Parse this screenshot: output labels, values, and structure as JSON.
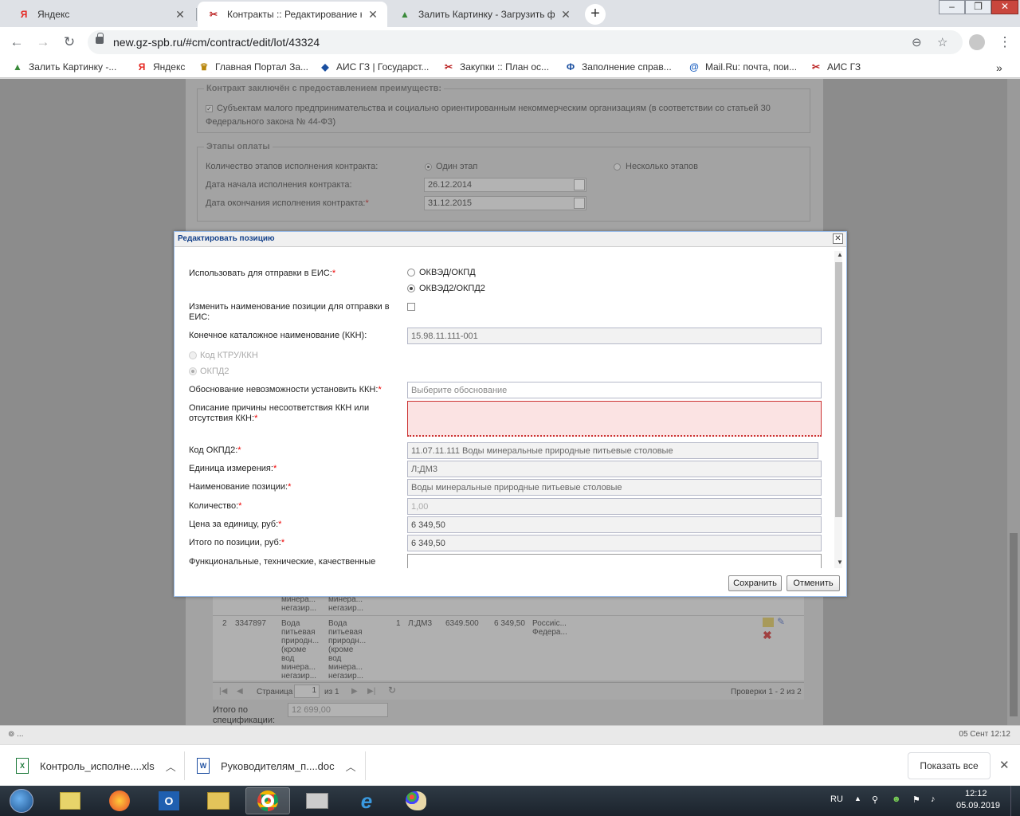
{
  "browser": {
    "tabs": [
      {
        "title": "Яндекс",
        "favicon": "Я"
      },
      {
        "title": "Контракты :: Редактирование ко",
        "favicon": "✂"
      },
      {
        "title": "Залить Картинку - Загрузить фо",
        "favicon": "▲"
      }
    ],
    "new_tab": "+",
    "url": "new.gz-spb.ru/#cm/contract/edit/lot/43324",
    "window_controls": {
      "minimize": "–",
      "restore": "❐",
      "close": "✕"
    },
    "bookmarks": [
      {
        "label": "Залить Картинку -...",
        "icon": "▲"
      },
      {
        "label": "Яндекс",
        "icon": "Я"
      },
      {
        "label": "Главная Портал За...",
        "icon": "♛"
      },
      {
        "label": "АИС ГЗ | Государст...",
        "icon": "◆"
      },
      {
        "label": "Закупки :: План ос...",
        "icon": "✂"
      },
      {
        "label": "Заполнение справ...",
        "icon": "Ф"
      },
      {
        "label": "Mail.Ru: почта, пои...",
        "icon": "@"
      },
      {
        "label": "АИС ГЗ",
        "icon": "✂"
      }
    ],
    "bookmarks_more": "»"
  },
  "background_form": {
    "preferences": {
      "legend": "Контракт заключён с предоставлением преимуществ:",
      "checkbox_text": "Субъектам малого предпринимательства и социально ориентированным некоммерческим организациям (в соответствии со статьей 30",
      "checkbox_text_2": "Федерального закона № 44-ФЗ)"
    },
    "payment": {
      "legend": "Этапы оплаты",
      "stages_label": "Количество этапов исполнения контракта:",
      "option_one": "Один этап",
      "option_many": "Несколько этапов",
      "start_label": "Дата начала исполнения контракта:",
      "start_value": "26.12.2014",
      "end_label": "Дата окончания исполнения контракта:",
      "end_value": "31.12.2015"
    },
    "grid": {
      "row1_frag": {
        "col3": "минера...\nнегазир...",
        "col4": "минера...\nнегазир..."
      },
      "row2": {
        "num": "2",
        "code": "3347897",
        "name": "Вода\nпитьевая\nприродн...\n(кроме\nвод\nминера...\nнегазир...",
        "name2": "Вода\nпитьевая\nприродн...\n(кроме\nвод\nминера...\nнегазир...",
        "qty": "1",
        "unit": "Л;ДМ3",
        "price": "6349.500",
        "total": "6 349,50",
        "country": "Россиiс...\nФедера..."
      },
      "pager": {
        "page_label": "Страница",
        "page_value": "1",
        "of_label": "из 1",
        "summary": "Проверки 1 - 2 из 2"
      }
    },
    "total_label": "Итого по\nспецификации:",
    "total_value": "12 699,00"
  },
  "status_bar": {
    "left": "⊚ ...",
    "right": "05 Сент 12:12"
  },
  "modal": {
    "title": "Редактировать позицию",
    "close": "✕",
    "fields": {
      "eis_label": "Использовать для отправки в ЕИС:",
      "eis_opt1": "ОКВЭД/ОКПД",
      "eis_opt2": "ОКВЭД2/ОКПД2",
      "rename_label": "Изменить наименование позиции для отправки в ЕИС:",
      "kkn_label": "Конечное каталожное наименование (ККН):",
      "kkn_value": "15.98.11.111-001",
      "ktru_opt": "Код КТРУ/ККН",
      "okpd2_opt": "ОКПД2",
      "reason_label": "Обоснование невозможности установить ККН:",
      "reason_placeholder": "Выберите обоснование",
      "desc_label": "Описание причины несоответствия ККН или отсутствия ККН:",
      "okpd2_label": "Код ОКПД2:",
      "okpd2_value": "11.07.11.111 Воды минеральные природные питьевые столовые",
      "unit_label": "Единица измерения:",
      "unit_value": "Л;ДМ3",
      "name_label": "Наименование позиции:",
      "name_value": "Воды минеральные природные питьевые столовые",
      "qty_label": "Количество:",
      "qty_value": "1,00",
      "price_label": "Цена за единицу, руб:",
      "price_value": "6 349,50",
      "total_label": "Итого по позиции, руб:",
      "total_value": "6 349,50",
      "func_label": "Функциональные, технические, качественные"
    },
    "required_mark": "*",
    "save": "Сохранить",
    "cancel": "Отменить"
  },
  "downloads": {
    "items": [
      {
        "name": "Контроль_исполне....xls",
        "icon": "X"
      },
      {
        "name": "Руководителям_п....doc",
        "icon": "W"
      }
    ],
    "show_all": "Показать все",
    "close": "✕"
  },
  "taskbar": {
    "lang": "RU",
    "time": "12:12",
    "date": "05.09.2019"
  }
}
